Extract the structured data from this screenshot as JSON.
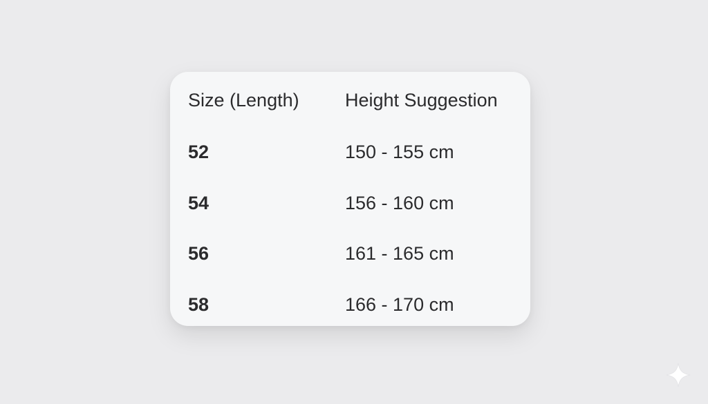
{
  "table": {
    "headers": {
      "size": "Size (Length)",
      "height": "Height Suggestion"
    },
    "rows": [
      {
        "size": "52",
        "height": "150 - 155 cm"
      },
      {
        "size": "54",
        "height": "156 - 160 cm"
      },
      {
        "size": "56",
        "height": "161 - 165 cm"
      },
      {
        "size": "58",
        "height": "166 - 170 cm"
      }
    ]
  },
  "colors": {
    "background": "#ebebed",
    "card": "#f6f7f8",
    "text": "#2b2b2d",
    "sparkle": "#ffffff"
  },
  "icons": {
    "corner": "sparkle-icon"
  }
}
